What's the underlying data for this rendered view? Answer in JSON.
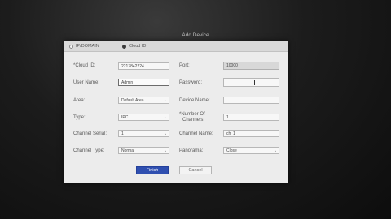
{
  "dialog": {
    "title": "Add Device",
    "tabs": [
      {
        "label": "IP/DOMAIN",
        "selected": false
      },
      {
        "label": "Cloud ID",
        "selected": true
      }
    ]
  },
  "form": {
    "cloud_id": {
      "label": "*Cloud ID:",
      "value": "2217842224"
    },
    "port": {
      "label": "Port:",
      "value": "10000"
    },
    "user_name": {
      "label": "User Name:",
      "value": "Admin"
    },
    "password": {
      "label": "Password:",
      "value": ""
    },
    "area": {
      "label": "Area:",
      "value": "Default Area"
    },
    "device_name": {
      "label": "Device Name:",
      "value": ""
    },
    "type": {
      "label": "Type:",
      "value": "IPC"
    },
    "number_of_channels": {
      "label_line1": "*Number Of",
      "label_line2": "Channels:",
      "value": "1"
    },
    "channel_serial": {
      "label": "Channel Serial:",
      "value": "1"
    },
    "channel_name": {
      "label": "Channel Name:",
      "value": "ch_1"
    },
    "channel_type": {
      "label": "Channel Type:",
      "value": "Normal"
    },
    "panorama": {
      "label": "Panorama:",
      "value": "Close"
    }
  },
  "buttons": {
    "finish": "Finish",
    "cancel": "Cancel"
  },
  "colors": {
    "primary_button": "#2f4fb0",
    "dialog_bg": "#ececec",
    "background": "#141414"
  }
}
